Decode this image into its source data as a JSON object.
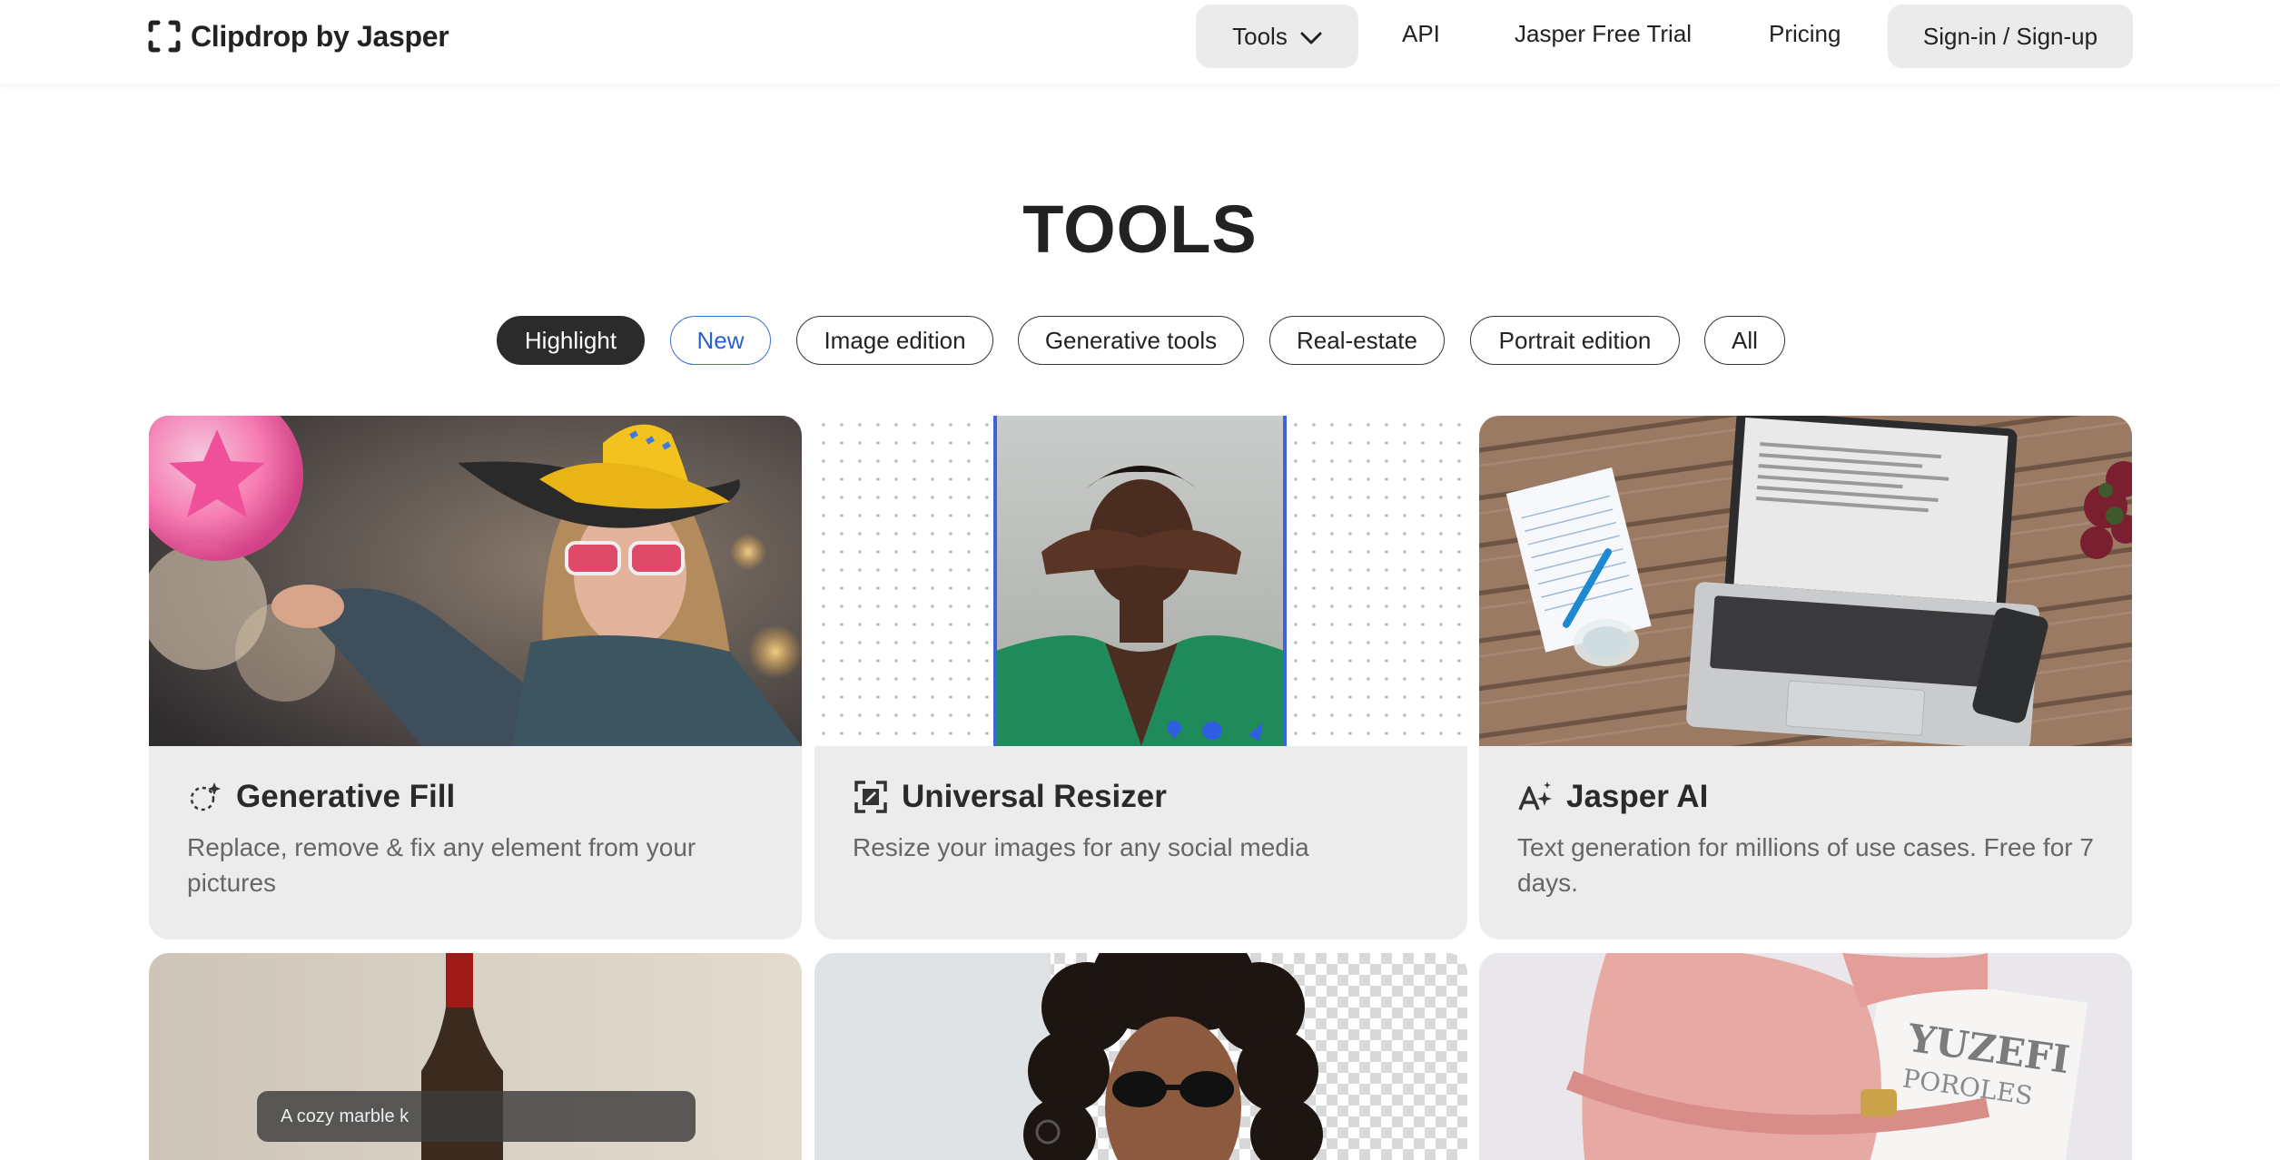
{
  "header": {
    "logo_text": "Clipdrop by Jasper",
    "nav": {
      "tools": "Tools",
      "api": "API",
      "trial": "Jasper Free Trial",
      "pricing": "Pricing",
      "signin": "Sign-in / Sign-up"
    }
  },
  "page": {
    "title": "TOOLS"
  },
  "filters": [
    {
      "label": "Highlight",
      "state": "selected"
    },
    {
      "label": "New",
      "state": "highlighted"
    },
    {
      "label": "Image edition",
      "state": "default"
    },
    {
      "label": "Generative tools",
      "state": "default"
    },
    {
      "label": "Real-estate",
      "state": "default"
    },
    {
      "label": "Portrait edition",
      "state": "default"
    },
    {
      "label": "All",
      "state": "default"
    }
  ],
  "cards": [
    {
      "title": "Generative Fill",
      "description": "Replace, remove & fix any element from your pictures",
      "icon": "generative-fill-icon"
    },
    {
      "title": "Universal Resizer",
      "description": "Resize your images for any social media",
      "icon": "resize-icon"
    },
    {
      "title": "Jasper AI",
      "description": "Text generation for millions of use cases. Free for 7 days.",
      "icon": "ai-text-icon"
    }
  ],
  "second_row": {
    "prompt_text": "A cozy marble k",
    "print_text_1": "YUZEFI",
    "print_text_2": "POROLES"
  },
  "colors": {
    "accent_blue": "#2a5fcf",
    "card_bg": "#ececec",
    "active_filter": "#2b2b2b",
    "nav_button_bg": "#ebebeb"
  }
}
